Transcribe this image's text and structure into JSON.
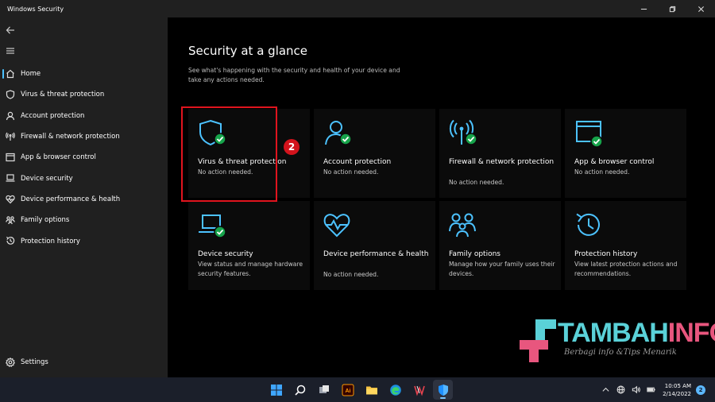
{
  "window": {
    "title": "Windows Security"
  },
  "sidebar": {
    "items": [
      {
        "label": "Home",
        "icon": "home-icon",
        "active": true
      },
      {
        "label": "Virus & threat protection",
        "icon": "shield-icon"
      },
      {
        "label": "Account protection",
        "icon": "person-icon"
      },
      {
        "label": "Firewall & network protection",
        "icon": "wifi-signal-icon"
      },
      {
        "label": "App & browser control",
        "icon": "browser-window-icon"
      },
      {
        "label": "Device security",
        "icon": "laptop-icon"
      },
      {
        "label": "Device performance & health",
        "icon": "heart-icon"
      },
      {
        "label": "Family options",
        "icon": "family-icon"
      },
      {
        "label": "Protection history",
        "icon": "history-icon"
      }
    ],
    "settings_label": "Settings"
  },
  "main": {
    "title": "Security at a glance",
    "subtitle": "See what's happening with the security and health of your device and take any actions needed.",
    "tiles": [
      {
        "title": "Virus & threat protection",
        "desc": "No action needed.",
        "icon": "shield-check-icon"
      },
      {
        "title": "Account protection",
        "desc": "No action needed.",
        "icon": "person-check-icon"
      },
      {
        "title": "Firewall & network protection",
        "desc": "No action needed.",
        "icon": "wifi-check-icon"
      },
      {
        "title": "App & browser control",
        "desc": "No action needed.",
        "icon": "browser-check-icon"
      },
      {
        "title": "Device security",
        "desc": "View status and manage hardware security features.",
        "icon": "laptop-check-icon"
      },
      {
        "title": "Device performance & health",
        "desc": "No action needed.",
        "icon": "heart-pulse-icon"
      },
      {
        "title": "Family options",
        "desc": "Manage how your family uses their devices.",
        "icon": "family-icon"
      },
      {
        "title": "Protection history",
        "desc": "View latest protection actions and recommendations.",
        "icon": "history-icon"
      }
    ],
    "step_badge": "2"
  },
  "watermark": {
    "name_part1": "TAMBAH",
    "name_part2": "INFO",
    "tagline": "Berbagi info &Tips Menarik"
  },
  "taskbar": {
    "time": "10:05 AM",
    "date": "2/14/2022",
    "notification_count": "2"
  },
  "colors": {
    "accent": "#4cc2ff",
    "ok_green": "#16a34a",
    "highlight_red": "#e0141e"
  }
}
